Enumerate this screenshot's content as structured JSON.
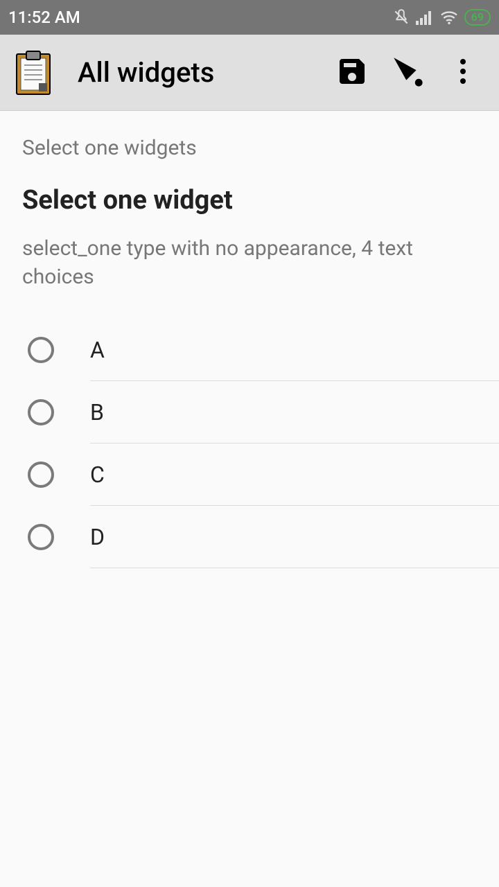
{
  "status": {
    "time": "11:52 AM",
    "battery": "69"
  },
  "appbar": {
    "title": "All widgets",
    "actions": {
      "save": "Save",
      "goto": "Go to",
      "more": "More"
    }
  },
  "content": {
    "breadcrumb": "Select one widgets",
    "question_title": "Select one widget",
    "question_hint": "select_one type with no appearance, 4 text choices",
    "options": [
      {
        "label": "A"
      },
      {
        "label": "B"
      },
      {
        "label": "C"
      },
      {
        "label": "D"
      }
    ]
  }
}
